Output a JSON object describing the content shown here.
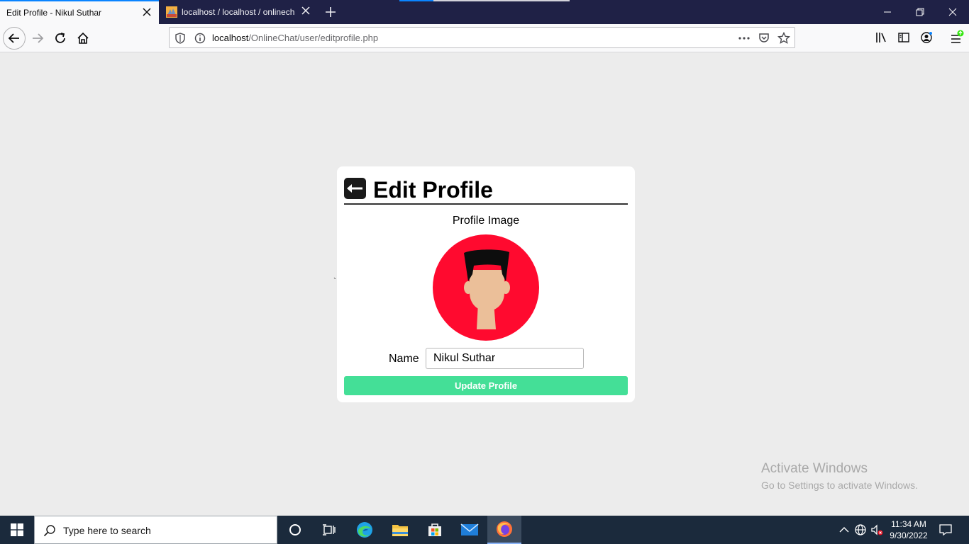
{
  "browser": {
    "tabs": [
      {
        "title": "Edit Profile - Nikul Suthar",
        "active": true
      },
      {
        "title": "localhost / localhost / onlinech",
        "active": false
      }
    ],
    "url_host": "localhost",
    "url_path": "/OnlineChat/user/editprofile.php"
  },
  "page": {
    "title": "Edit Profile",
    "profile_image_label": "Profile Image",
    "name_label": "Name",
    "name_value": "Nikul Suthar",
    "update_button": "Update Profile",
    "stray_mark": "`"
  },
  "watermark": {
    "title": "Activate Windows",
    "subtitle": "Go to Settings to activate Windows."
  },
  "taskbar": {
    "search_placeholder": "Type here to search",
    "time": "11:34 AM",
    "date": "9/30/2022"
  },
  "colors": {
    "accent_button": "#44df97",
    "avatar_bg": "#ff0a2f",
    "tab_bar": "#1f2146",
    "taskbar": "#1b2a3c"
  }
}
